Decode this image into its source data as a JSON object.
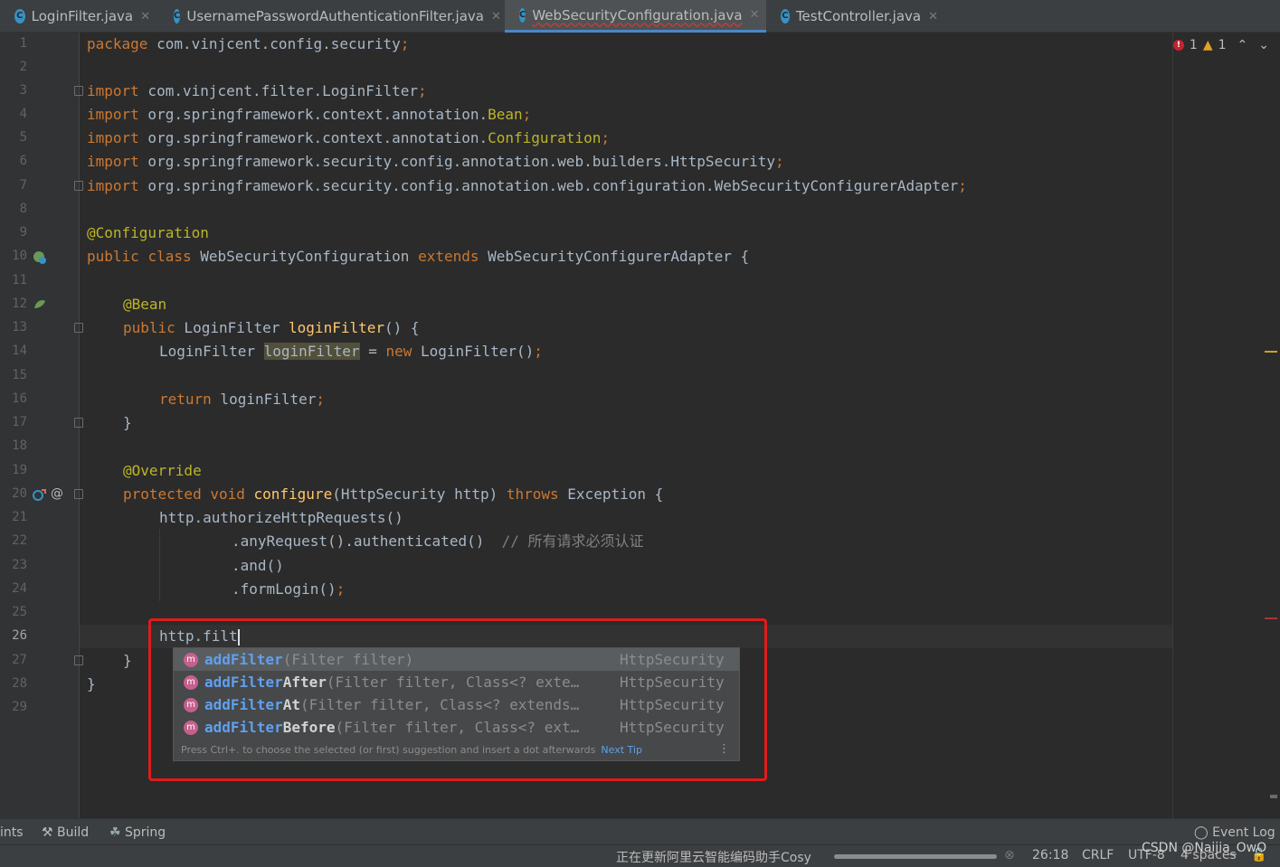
{
  "tabs": [
    {
      "label": "LoginFilter.java",
      "icon": "C",
      "active": false
    },
    {
      "label": "UsernamePasswordAuthenticationFilter.java",
      "icon": "C",
      "active": false
    },
    {
      "label": "WebSecurityConfiguration.java",
      "icon": "C",
      "active": true
    },
    {
      "label": "TestController.java",
      "icon": "C",
      "active": false
    }
  ],
  "tab_close": "✕",
  "inspections": {
    "errors": "1",
    "warnings": "1"
  },
  "line_numbers": [
    "1",
    "2",
    "3",
    "4",
    "5",
    "6",
    "7",
    "8",
    "9",
    "10",
    "11",
    "12",
    "13",
    "14",
    "15",
    "16",
    "17",
    "18",
    "19",
    "20",
    "21",
    "22",
    "23",
    "24",
    "25",
    "26",
    "27",
    "28",
    "29"
  ],
  "code": {
    "l1_kw": "package",
    "l1_rest": " com.vinjcent.config.security",
    "semi": ";",
    "imp": "import",
    "l3": " com.vinjcent.filter.LoginFilter",
    "l4_pre": " org.springframework.context.annotation.",
    "l4_cls": "Bean",
    "l5_pre": " org.springframework.context.annotation.",
    "l5_cls": "Configuration",
    "l6": " org.springframework.security.config.annotation.web.builders.HttpSecurity",
    "l7": " org.springframework.security.config.annotation.web.configuration.WebSecurityConfigurerAdapter",
    "l9": "@Configuration",
    "l10_public": "public",
    "l10_class": "class",
    "l10_name": " WebSecurityConfiguration ",
    "l10_extends": "extends",
    "l10_rest": " WebSecurityConfigurerAdapter {",
    "l12": "@Bean",
    "l13_public": "public",
    "l13_type": " LoginFilter ",
    "l13_fn": "loginFilter",
    "l13_rest": "() {",
    "l14_type": "LoginFilter ",
    "l14_var": "loginFilter",
    "l14_eq": " = ",
    "l14_new": "new",
    "l14_rest": " LoginFilter()",
    "l16_ret": "return",
    "l16_rest": " loginFilter",
    "brace_close": "}",
    "l19": "@Override",
    "l20_prot": "protected",
    "l20_void": " void ",
    "l20_fn": "configure",
    "l20_params": "(HttpSecurity http) ",
    "l20_throws": "throws",
    "l20_rest": " Exception {",
    "l21": "http.authorizeHttpRequests()",
    "l22": ".anyRequest().authenticated()",
    "l22_comment": "// 所有请求必须认证",
    "l23": ".and()",
    "l24": ".formLogin()",
    "l26": "http.filt"
  },
  "completion": {
    "items": [
      {
        "match": "addFilter",
        "rest": "",
        "sig": "(Filter filter)",
        "type": "HttpSecurity"
      },
      {
        "match": "addFilter",
        "rest": "After",
        "sig": "(Filter filter, Class<? exte…",
        "type": "HttpSecurity"
      },
      {
        "match": "addFilter",
        "rest": "At",
        "sig": "(Filter filter, Class<? extends…",
        "type": "HttpSecurity"
      },
      {
        "match": "addFilter",
        "rest": "Before",
        "sig": "(Filter filter, Class<? ext…",
        "type": "HttpSecurity"
      }
    ],
    "item_icon": "m",
    "tip": "Press Ctrl+. to choose the selected (or first) suggestion and insert a dot afterwards",
    "next_tip": "Next Tip"
  },
  "bottom_tools": {
    "hints": "ints",
    "build": "Build",
    "spring": "Spring",
    "event_log": "Event Log"
  },
  "status": {
    "task": "正在更新阿里云智能编码助手Cosy",
    "position": "26:18",
    "line_sep": "CRLF",
    "encoding": "UTF-8",
    "indent": "4 spaces"
  },
  "watermark": "CSDN @Naijia_OwO",
  "colors": {
    "accent": "#4a88c7",
    "keyword": "#cc7832",
    "annotation": "#bbb529",
    "function": "#ffc66d",
    "match": "#5fa0ef",
    "redbox": "#e01b1b"
  }
}
